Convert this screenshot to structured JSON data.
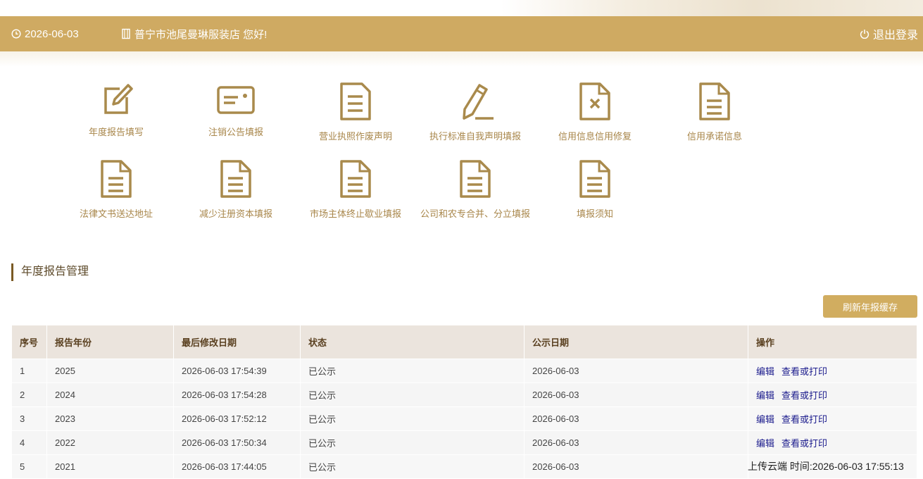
{
  "header": {
    "date": "2026-06-03",
    "greeting": "普宁市池尾曼琳服装店 您好!",
    "logout_label": "退出登录"
  },
  "menu": [
    {
      "label": "年度报告填写",
      "icon": "edit-icon"
    },
    {
      "label": "注销公告填报",
      "icon": "card-icon"
    },
    {
      "label": "营业执照作废声明",
      "icon": "document-icon"
    },
    {
      "label": "执行标准自我声明填报",
      "icon": "pencil-icon"
    },
    {
      "label": "信用信息信用修复",
      "icon": "document-x-icon"
    },
    {
      "label": "信用承诺信息",
      "icon": "document-icon"
    },
    {
      "label": "法律文书送达地址",
      "icon": "document-icon"
    },
    {
      "label": "减少注册资本填报",
      "icon": "document-icon"
    },
    {
      "label": "市场主体终止歇业填报",
      "icon": "document-icon"
    },
    {
      "label": "公司和农专合并、分立填报",
      "icon": "document-icon"
    },
    {
      "label": "填报须知",
      "icon": "document-icon"
    }
  ],
  "section": {
    "title": "年度报告管理",
    "refresh_label": "刷新年报缓存"
  },
  "table": {
    "headers": [
      "序号",
      "报告年份",
      "最后修改日期",
      "状态",
      "公示日期",
      "操作"
    ],
    "edit_label": "编辑",
    "view_label": "查看或打印",
    "rows": [
      [
        "1",
        "2025",
        "2026-06-03 17:54:39",
        "已公示",
        "2026-06-03"
      ],
      [
        "2",
        "2024",
        "2026-06-03 17:54:28",
        "已公示",
        "2026-06-03"
      ],
      [
        "3",
        "2023",
        "2026-06-03 17:52:12",
        "已公示",
        "2026-06-03"
      ],
      [
        "4",
        "2022",
        "2026-06-03 17:50:34",
        "已公示",
        "2026-06-03"
      ],
      [
        "5",
        "2021",
        "2026-06-03 17:44:05",
        "已公示",
        "2026-06-03"
      ]
    ]
  },
  "status_overlay": "上传云端  时间:2026-06-03 17:55:13",
  "colors": {
    "header": "#cfaa62",
    "icon": "#a98a4c",
    "button": "#d1ad60"
  }
}
